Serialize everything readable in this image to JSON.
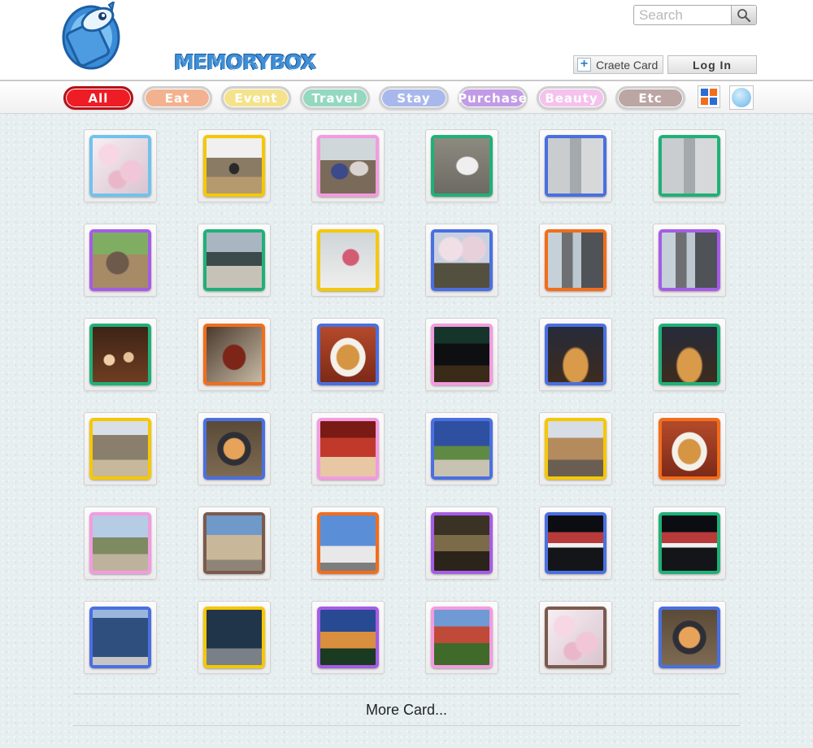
{
  "header": {
    "logo_text": "MEMORYBOX",
    "search_placeholder": "Search",
    "create_label": "Craete Card",
    "login_label": "Log In"
  },
  "categories": [
    {
      "label": "All",
      "color": "#ee1c25",
      "border": "#b41018"
    },
    {
      "label": "Eat",
      "color": "#f3b28f",
      "border": "#cfcfcf"
    },
    {
      "label": "Event",
      "color": "#f4e38c",
      "border": "#cfcfcf"
    },
    {
      "label": "Travel",
      "color": "#94d8c0",
      "border": "#cfcfcf"
    },
    {
      "label": "Stay",
      "color": "#a9b8ec",
      "border": "#cfcfcf"
    },
    {
      "label": "Purchase",
      "color": "#c29be6",
      "border": "#cfcfcf"
    },
    {
      "label": "Beauty",
      "color": "#f4c2ec",
      "border": "#cfcfcf"
    },
    {
      "label": "Etc",
      "color": "#bba6a3",
      "border": "#cfcfcf"
    }
  ],
  "view_icons": [
    "grid-view-icon",
    "circle-view-icon"
  ],
  "frame_colors": {
    "lightblue": "#6ec3ee",
    "yellow": "#f5c800",
    "pink": "#f39be0",
    "green": "#1fb078",
    "blue": "#4a6fe0",
    "purple": "#a65ce6",
    "orange": "#f36d1a",
    "brown": "#7b5a4d"
  },
  "cards": [
    {
      "frame": "lightblue",
      "photo": "cherry-blossom"
    },
    {
      "frame": "yellow",
      "photo": "man-mountain-view"
    },
    {
      "frame": "pink",
      "photo": "couple-on-boat"
    },
    {
      "frame": "green",
      "photo": "astronaut-statue"
    },
    {
      "frame": "blue",
      "photo": "bicycle-by-building"
    },
    {
      "frame": "green",
      "photo": "bicycle-by-building"
    },
    {
      "frame": "purple",
      "photo": "elephant-ride"
    },
    {
      "frame": "green",
      "photo": "arena-roof"
    },
    {
      "frame": "yellow",
      "photo": "pink-dessert"
    },
    {
      "frame": "blue",
      "photo": "cherry-trees"
    },
    {
      "frame": "orange",
      "photo": "canal-towers"
    },
    {
      "frame": "purple",
      "photo": "canal-towers"
    },
    {
      "frame": "green",
      "photo": "party-crowd"
    },
    {
      "frame": "orange",
      "photo": "steak-dish"
    },
    {
      "frame": "blue",
      "photo": "fried-cutlet-plate"
    },
    {
      "frame": "pink",
      "photo": "night-sign"
    },
    {
      "frame": "blue",
      "photo": "restaurant-night"
    },
    {
      "frame": "green",
      "photo": "restaurant-night"
    },
    {
      "frame": "yellow",
      "photo": "shop-front"
    },
    {
      "frame": "blue",
      "photo": "rice-bowl"
    },
    {
      "frame": "pink",
      "photo": "red-dining-room"
    },
    {
      "frame": "blue",
      "photo": "visa-office"
    },
    {
      "frame": "yellow",
      "photo": "colonial-house"
    },
    {
      "frame": "orange",
      "photo": "fried-cutlet-plate"
    },
    {
      "frame": "pink",
      "photo": "hillside-building"
    },
    {
      "frame": "brown",
      "photo": "palm-building"
    },
    {
      "frame": "orange",
      "photo": "white-building-sky"
    },
    {
      "frame": "purple",
      "photo": "dim-interior"
    },
    {
      "frame": "blue",
      "photo": "dark-shop-window"
    },
    {
      "frame": "green",
      "photo": "dark-shop-window"
    },
    {
      "frame": "blue",
      "photo": "glass-tower"
    },
    {
      "frame": "yellow",
      "photo": "dark-building-sign"
    },
    {
      "frame": "purple",
      "photo": "hotel-dusk"
    },
    {
      "frame": "pink",
      "photo": "red-resort"
    },
    {
      "frame": "brown",
      "photo": "cherry-blossom"
    },
    {
      "frame": "blue",
      "photo": "rice-bowl"
    }
  ],
  "more_label": "More Card..."
}
